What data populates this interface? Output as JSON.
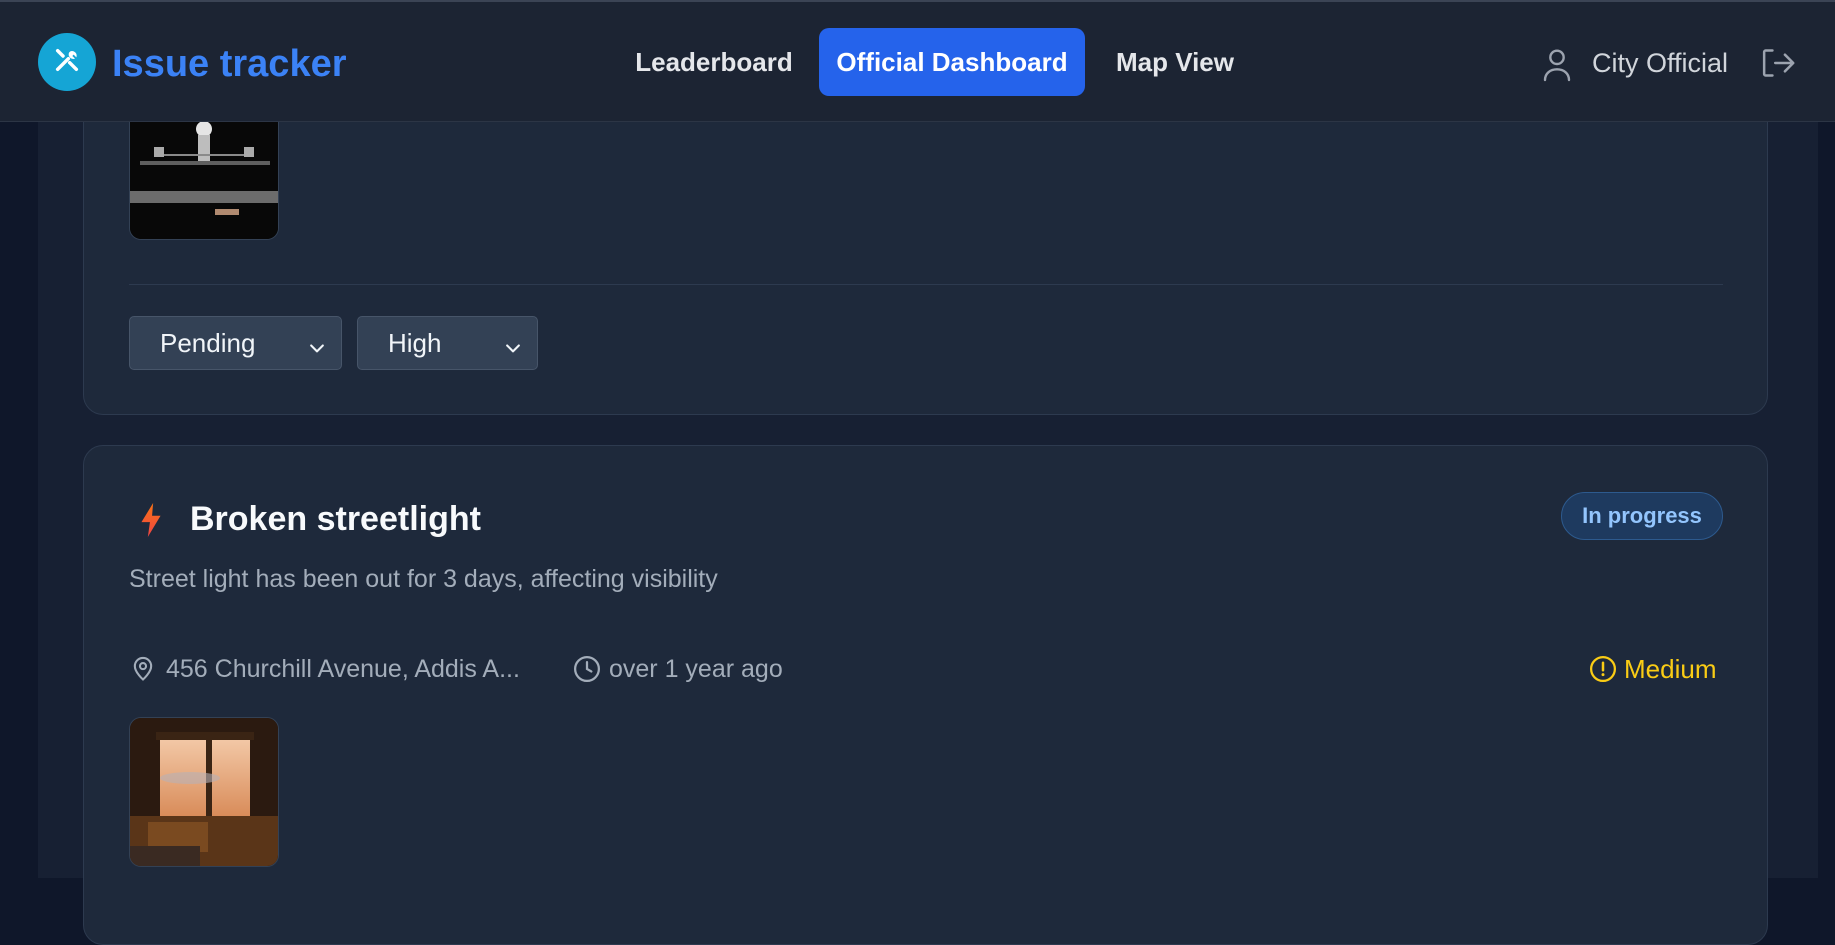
{
  "header": {
    "brand": "Issue tracker",
    "nav": {
      "leaderboard": "Leaderboard",
      "dashboard": "Official Dashboard",
      "map": "Map View"
    },
    "user": "City Official"
  },
  "card1": {
    "status_select": "Pending",
    "priority_select": "High"
  },
  "card2": {
    "title": "Broken streetlight",
    "status": "In progress",
    "description": "Street light has been out for 3 days, affecting visibility",
    "location": "456 Churchill Avenue, Addis A...",
    "time": "over 1 year ago",
    "priority": "Medium"
  },
  "colors": {
    "accent": "#2563eb",
    "brand": "#3b82f6",
    "priority_medium": "#facc15",
    "status_in_progress": "#93c5fd"
  },
  "icons": [
    "tools-icon",
    "user-icon",
    "logout-icon",
    "chevron-down-icon",
    "bolt-icon",
    "map-pin-icon",
    "clock-icon",
    "alert-circle-icon"
  ]
}
